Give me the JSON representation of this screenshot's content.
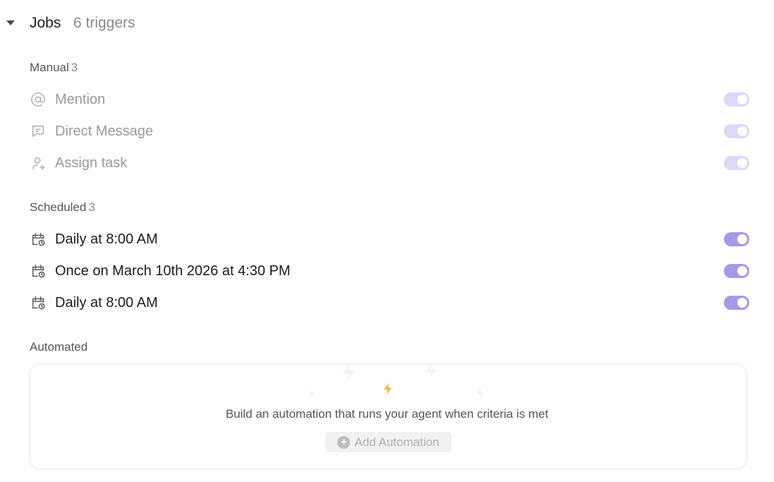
{
  "header": {
    "title": "Jobs",
    "count": "6 triggers"
  },
  "sections": {
    "manual": {
      "label": "Manual",
      "count": "3",
      "items": [
        {
          "label": "Mention",
          "icon": "at-icon",
          "enabled": true
        },
        {
          "label": "Direct Message",
          "icon": "message-icon",
          "enabled": true
        },
        {
          "label": "Assign task",
          "icon": "assign-user-icon",
          "enabled": true
        }
      ]
    },
    "scheduled": {
      "label": "Scheduled",
      "count": "3",
      "items": [
        {
          "label": "Daily at 8:00 AM",
          "icon": "calendar-clock-icon",
          "enabled": true
        },
        {
          "label": "Once on March 10th 2026 at 4:30 PM",
          "icon": "calendar-clock-icon",
          "enabled": true
        },
        {
          "label": "Daily at 8:00 AM",
          "icon": "calendar-clock-icon",
          "enabled": true
        }
      ]
    },
    "automated": {
      "label": "Automated",
      "empty_text": "Build an automation that runs your agent when criteria is met",
      "add_label": "Add Automation",
      "icon": "lightning-icon"
    }
  },
  "colors": {
    "toggle_on": "#a59ae6",
    "toggle_dim": "#dcd8f5",
    "lightning": "#f0b63a"
  }
}
